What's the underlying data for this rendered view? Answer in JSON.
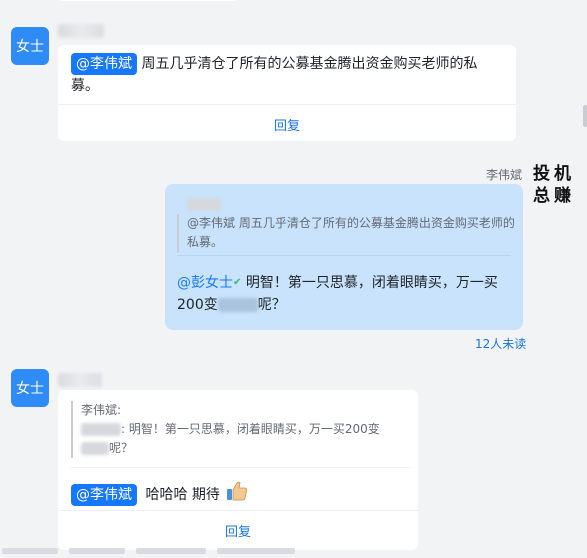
{
  "msg1": {
    "avatar_text": "女士",
    "mention": "@李伟斌",
    "text": "周五几乎清仓了所有的公募基金腾出资金购买老师的私募。",
    "reply": "回复"
  },
  "msg2": {
    "sender_name": "李伟斌",
    "calligraphy_text": "投机总赚",
    "quote_text": "@李伟斌 周五几乎清仓了所有的公募基金腾出资金购买老师的私募。",
    "mention": "@彭女士",
    "text_before": "明智！第一只思慕，闭着眼睛买，万一买200变",
    "text_after": "呢？",
    "unread": "12人未读"
  },
  "msg3": {
    "avatar_text": "女士",
    "quote_author": "李伟斌:",
    "quote_text_1": ": 明智！第一只思慕，闭着眼睛买，万一买200变",
    "quote_text_2": "呢？",
    "mention": "@李伟斌",
    "text": "哈哈哈 期待",
    "reply": "回复"
  },
  "colors": {
    "accent": "#1677ff",
    "bubble": "#c8e3fb",
    "background": "#f2f3f5"
  }
}
